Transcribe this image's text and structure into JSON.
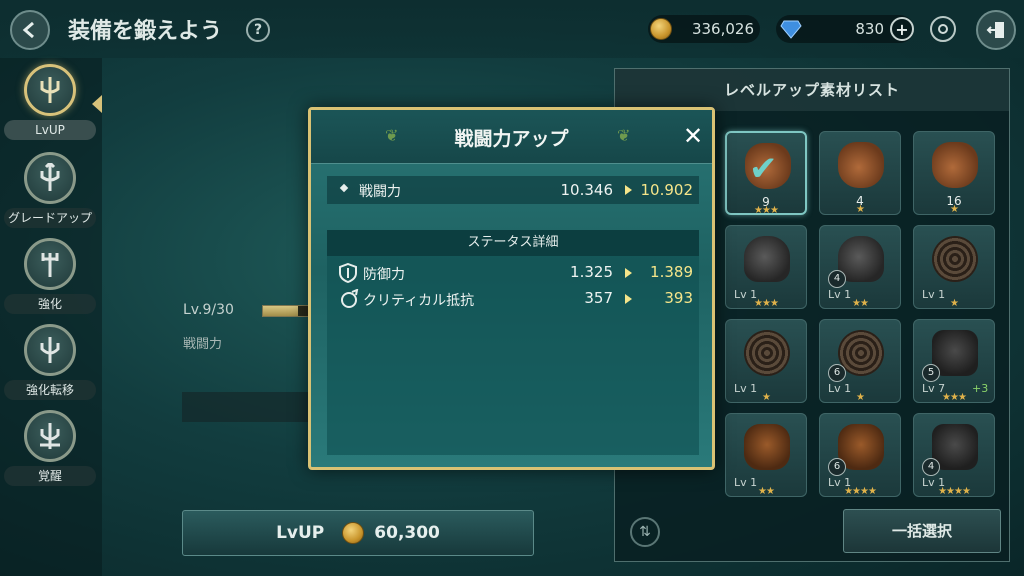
{
  "header": {
    "title": "装備を鍛えよう",
    "help": "?",
    "gold": "336,026",
    "gems": "830",
    "plus": "+"
  },
  "sidebar": {
    "items": [
      {
        "label": "LvUP",
        "active": true
      },
      {
        "label": "グレードアップ"
      },
      {
        "label": "強化"
      },
      {
        "label": "強化転移"
      },
      {
        "label": "覚醒"
      }
    ]
  },
  "main": {
    "level": "Lv.9/30",
    "level_progress": 0.6,
    "power_label": "戦闘力",
    "lvup_button": "LvUP",
    "lvup_cost": "60,300"
  },
  "materials": {
    "title": "レベルアップ素材リスト",
    "bulk_select": "一括選択",
    "items": [
      {
        "kind": "bag",
        "qty": "9",
        "stars": 3,
        "selected": true
      },
      {
        "kind": "bag",
        "qty": "4",
        "stars": 1
      },
      {
        "kind": "bag",
        "qty": "16",
        "stars": 1
      },
      {
        "kind": "helm",
        "lv": "Lv 1",
        "stars": 3
      },
      {
        "kind": "helm",
        "lv": "Lv 1",
        "badge": "4",
        "stars": 2
      },
      {
        "kind": "coil",
        "lv": "Lv 1",
        "stars": 1
      },
      {
        "kind": "coil",
        "lv": "Lv 1",
        "stars": 1
      },
      {
        "kind": "coil",
        "lv": "Lv 1",
        "badge": "6",
        "stars": 1
      },
      {
        "kind": "armor",
        "lv": "Lv 7",
        "badge": "5",
        "plus": "+3",
        "stars": 3
      },
      {
        "kind": "leather",
        "lv": "Lv 1",
        "stars": 2
      },
      {
        "kind": "leather",
        "lv": "Lv 1",
        "badge": "6",
        "stars": 4
      },
      {
        "kind": "armor",
        "lv": "Lv 1",
        "badge": "4",
        "stars": 4
      }
    ]
  },
  "modal": {
    "title": "戦闘力アップ",
    "close": "✕",
    "power": {
      "label": "戦闘力",
      "old": "10.346",
      "new": "10.902"
    },
    "detail_title": "ステータス詳細",
    "stats": [
      {
        "label": "防御力",
        "old": "1.325",
        "new": "1.389",
        "icon": "shield-icon"
      },
      {
        "label": "クリティカル抵抗",
        "old": "357",
        "new": "393",
        "icon": "crit-resist-icon"
      }
    ]
  }
}
